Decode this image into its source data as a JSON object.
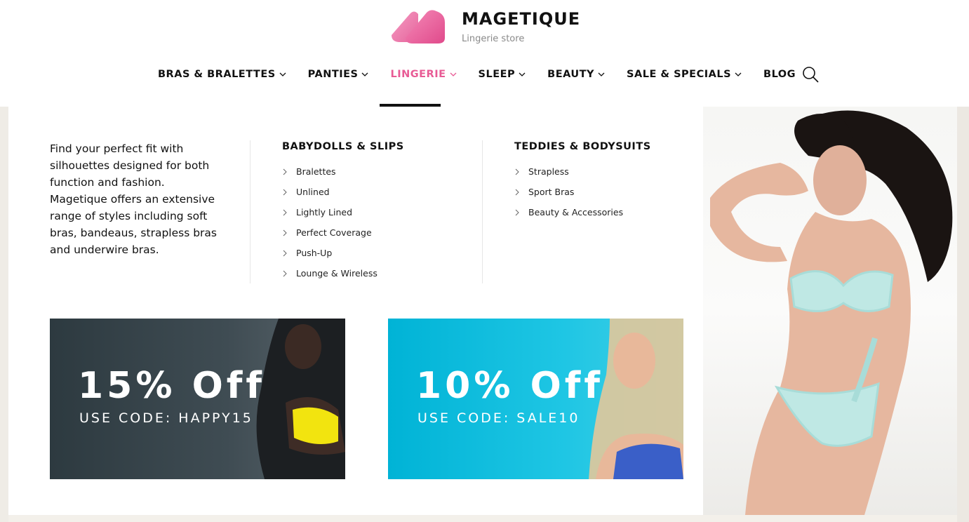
{
  "brand": {
    "name": "MAGETIQUE",
    "tagline": "Lingerie store",
    "logo_colors": [
      "#f06ba4",
      "#e04a8b"
    ]
  },
  "nav": {
    "items": [
      {
        "label": "BRAS & BRALETTES",
        "has_dropdown": true
      },
      {
        "label": "PANTIES",
        "has_dropdown": true
      },
      {
        "label": "LINGERIE",
        "has_dropdown": true,
        "active": true
      },
      {
        "label": "SLEEP",
        "has_dropdown": true
      },
      {
        "label": "BEAUTY",
        "has_dropdown": true
      },
      {
        "label": "SALE & SPECIALS",
        "has_dropdown": true
      },
      {
        "label": "BLOG",
        "has_dropdown": false
      }
    ],
    "active_color": "#e85b95",
    "search_icon": "search-icon"
  },
  "mega_menu": {
    "intro": "Find your perfect fit with silhouettes designed for both function and fashion. Magetique offers an extensive range of styles including soft bras, bandeaus, strapless bras and underwire bras.",
    "columns": [
      {
        "title": "BABYDOLLS & SLIPS",
        "items": [
          "Bralettes",
          "Unlined",
          "Lightly Lined",
          "Perfect Coverage",
          "Push-Up",
          "Lounge & Wireless"
        ]
      },
      {
        "title": "TEDDIES & BODYSUITS",
        "items": [
          "Strapless",
          "Sport Bras",
          "Beauty & Accessories"
        ]
      }
    ],
    "banners": [
      {
        "title": "15% Off",
        "code": "USE CODE: HAPPY15",
        "bg_color": "#36444a"
      },
      {
        "title": "10% Off",
        "code": "USE CODE: SALE10",
        "bg_color": "#0fbedd"
      }
    ]
  }
}
